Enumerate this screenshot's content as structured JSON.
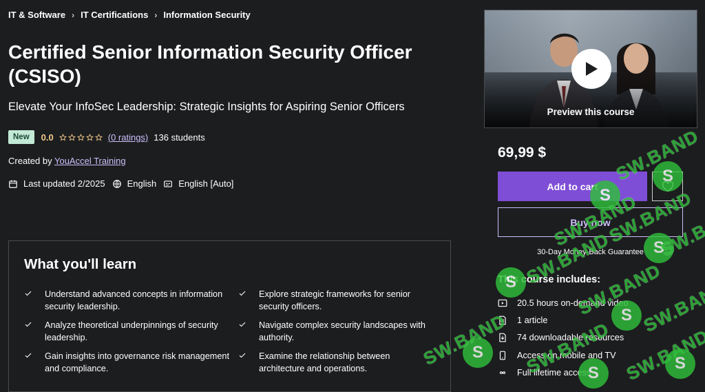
{
  "breadcrumb": [
    "IT & Software",
    "IT Certifications",
    "Information Security"
  ],
  "course": {
    "title": "Certified Senior Information Security Officer (CSISO)",
    "subtitle": "Elevate Your InfoSec Leadership: Strategic Insights for Aspiring Senior Officers",
    "badge": "New",
    "rating": "0.0",
    "rating_stars": 0,
    "ratings_link": "(0 ratings)",
    "students": "136 students",
    "created_by_prefix": "Created by",
    "instructor": "YouAccel Training",
    "last_updated": "Last updated 2/2025",
    "language": "English",
    "captions": "English [Auto]"
  },
  "learn": {
    "heading": "What you'll learn",
    "items": [
      "Understand advanced concepts in information security leadership.",
      "Explore strategic frameworks for senior security officers.",
      "Analyze theoretical underpinnings of security leadership.",
      "Navigate complex security landscapes with authority.",
      "Gain insights into governance risk management and compliance.",
      "Examine the relationship between architecture and operations."
    ]
  },
  "sidebar": {
    "preview_label": "Preview this course",
    "price": "69,99 $",
    "add_to_cart": "Add to cart",
    "buy_now": "Buy now",
    "guarantee": "30-Day Money-Back Guarantee",
    "includes_heading": "This course includes:",
    "includes": [
      {
        "icon": "video-icon",
        "text": "20.5 hours on-demand video"
      },
      {
        "icon": "article-icon",
        "text": "1 article"
      },
      {
        "icon": "download-icon",
        "text": "74 downloadable resources"
      },
      {
        "icon": "mobile-icon",
        "text": "Access on mobile and TV"
      },
      {
        "icon": "infinity-icon",
        "text": "Full lifetime access"
      }
    ]
  },
  "watermark": "SW.BAND",
  "colors": {
    "background": "#1c1d1f",
    "accent_purple": "#7f4ed6",
    "link_purple": "#cec0fc",
    "rating_gold": "#f3ca8c",
    "badge_green": "#c2e9d5",
    "watermark_green": "#2fbf3a"
  }
}
